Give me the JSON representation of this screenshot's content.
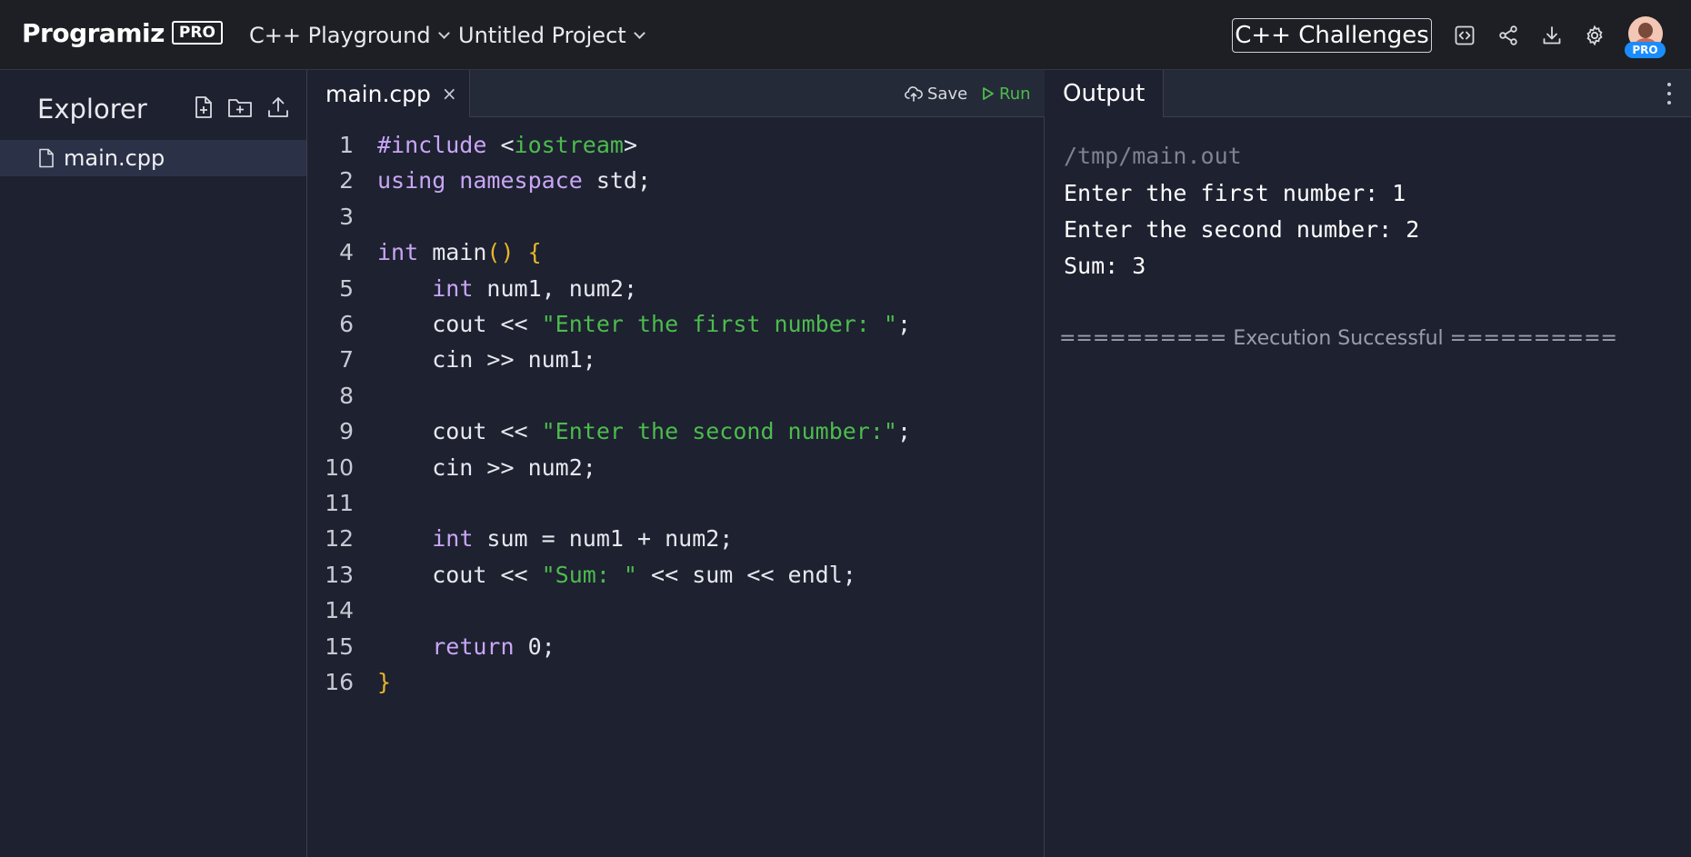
{
  "topbar": {
    "logo_text": "Programiz",
    "logo_badge": "PRO",
    "menu_playground": "C++ Playground",
    "menu_project": "Untitled Project",
    "challenges_label": "C++ Challenges",
    "icons": [
      "embed-icon",
      "share-icon",
      "download-icon",
      "settings-icon"
    ],
    "avatar_badge": "PRO"
  },
  "explorer": {
    "title": "Explorer",
    "icons": [
      "new-file-icon",
      "new-folder-icon",
      "upload-icon"
    ],
    "files": [
      {
        "name": "main.cpp",
        "icon": "file-icon",
        "selected": true
      }
    ]
  },
  "editor": {
    "tab_label": "main.cpp",
    "tab_close": "×",
    "save_label": "Save",
    "run_label": "Run",
    "lines": [
      {
        "n": "1",
        "tokens": [
          [
            "pp",
            "#include "
          ],
          [
            "pl",
            "<"
          ],
          [
            "str",
            "iostream"
          ],
          [
            "pl",
            ">"
          ]
        ]
      },
      {
        "n": "2",
        "tokens": [
          [
            "kw",
            "using namespace"
          ],
          [
            "pl",
            " std;"
          ]
        ]
      },
      {
        "n": "3",
        "tokens": []
      },
      {
        "n": "4",
        "tokens": [
          [
            "kw",
            "int"
          ],
          [
            "pl",
            " main"
          ],
          [
            "br",
            "() {"
          ]
        ]
      },
      {
        "n": "5",
        "tokens": [
          [
            "pl",
            "    "
          ],
          [
            "kw",
            "int"
          ],
          [
            "pl",
            " num1, num2;"
          ]
        ]
      },
      {
        "n": "6",
        "tokens": [
          [
            "pl",
            "    cout << "
          ],
          [
            "str",
            "\"Enter the first number: \""
          ],
          [
            "pl",
            ";"
          ]
        ]
      },
      {
        "n": "7",
        "tokens": [
          [
            "pl",
            "    cin >> num1;"
          ]
        ]
      },
      {
        "n": "8",
        "tokens": []
      },
      {
        "n": "9",
        "tokens": [
          [
            "pl",
            "    cout << "
          ],
          [
            "str",
            "\"Enter the second number:\""
          ],
          [
            "pl",
            ";"
          ]
        ]
      },
      {
        "n": "10",
        "tokens": [
          [
            "pl",
            "    cin >> num2;"
          ]
        ]
      },
      {
        "n": "11",
        "tokens": []
      },
      {
        "n": "12",
        "tokens": [
          [
            "pl",
            "    "
          ],
          [
            "kw",
            "int"
          ],
          [
            "pl",
            " sum = num1 + num2;"
          ]
        ]
      },
      {
        "n": "13",
        "tokens": [
          [
            "pl",
            "    cout << "
          ],
          [
            "str",
            "\"Sum: \""
          ],
          [
            "pl",
            " << sum << endl;"
          ]
        ]
      },
      {
        "n": "14",
        "tokens": []
      },
      {
        "n": "15",
        "tokens": [
          [
            "pl",
            "    "
          ],
          [
            "kw",
            "return"
          ],
          [
            "pl",
            " 0;"
          ]
        ]
      },
      {
        "n": "16",
        "tokens": [
          [
            "br",
            "}"
          ]
        ]
      }
    ]
  },
  "output": {
    "tab_label": "Output",
    "path": "/tmp/main.out",
    "lines": [
      "Enter the first number: 1",
      "Enter the second number: 2",
      "Sum: 3"
    ],
    "status": "========== Execution Successful =========="
  },
  "colors": {
    "background": "#1d2130",
    "topbar": "#1e1f24",
    "keyword": "#c9a6f5",
    "string": "#4dbb4d",
    "bracket": "#e7b52b",
    "run": "#4dbb4d",
    "pro_badge": "#1a8cff"
  }
}
